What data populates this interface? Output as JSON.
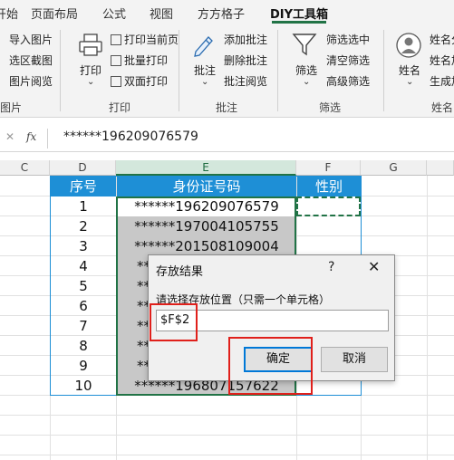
{
  "tabs": [
    {
      "label": "开始"
    },
    {
      "label": "页面布局"
    },
    {
      "label": "公式"
    },
    {
      "label": "视图"
    },
    {
      "label": "方方格子"
    },
    {
      "label": "DIY工具箱"
    }
  ],
  "ribbon": {
    "pictures": {
      "items": [
        "导入图片",
        "选区截图",
        "图片阅览"
      ],
      "group_label": "图片"
    },
    "print": {
      "big_label": "打印",
      "items": [
        "打印当前页",
        "批量打印",
        "双面打印"
      ],
      "group_label": "打印"
    },
    "comments": {
      "big_label": "批注",
      "items": [
        "添加批注",
        "删除批注",
        "批注阅览"
      ],
      "group_label": "批注"
    },
    "filter": {
      "big_label": "筛选",
      "items": [
        "筛选选中",
        "清空筛选",
        "高级筛选"
      ],
      "group_label": "筛选"
    },
    "names": {
      "big_label": "姓名",
      "items": [
        "姓名分",
        "姓名加",
        "生成加"
      ],
      "group_label": "姓名"
    }
  },
  "formula_bar": {
    "cancel_glyph": "✕",
    "fx_label": "fx",
    "content": "******196209076579"
  },
  "columns": [
    "C",
    "D",
    "E",
    "F",
    "G"
  ],
  "table": {
    "headers": [
      "序号",
      "身份证号码",
      "性别"
    ],
    "rows": [
      {
        "no": "1",
        "id": "******196209076579"
      },
      {
        "no": "2",
        "id": "******197004105755"
      },
      {
        "no": "3",
        "id": "******201508109004"
      },
      {
        "no": "4",
        "id": "**"
      },
      {
        "no": "5",
        "id": "**"
      },
      {
        "no": "6",
        "id": "**"
      },
      {
        "no": "7",
        "id": "**"
      },
      {
        "no": "8",
        "id": "**"
      },
      {
        "no": "9",
        "id": "**"
      },
      {
        "no": "10",
        "id": "******196807157622"
      }
    ]
  },
  "dialog": {
    "title": "存放结果",
    "help": "?",
    "close": "✕",
    "prompt": "请选择存放位置（只需一个单元格）",
    "input_value": "$F$2",
    "ok_label": "确定",
    "cancel_label": "取消"
  },
  "colors": {
    "accent": "#217346",
    "table_header": "#1e8fd6",
    "highlight_box": "#e0201b"
  }
}
